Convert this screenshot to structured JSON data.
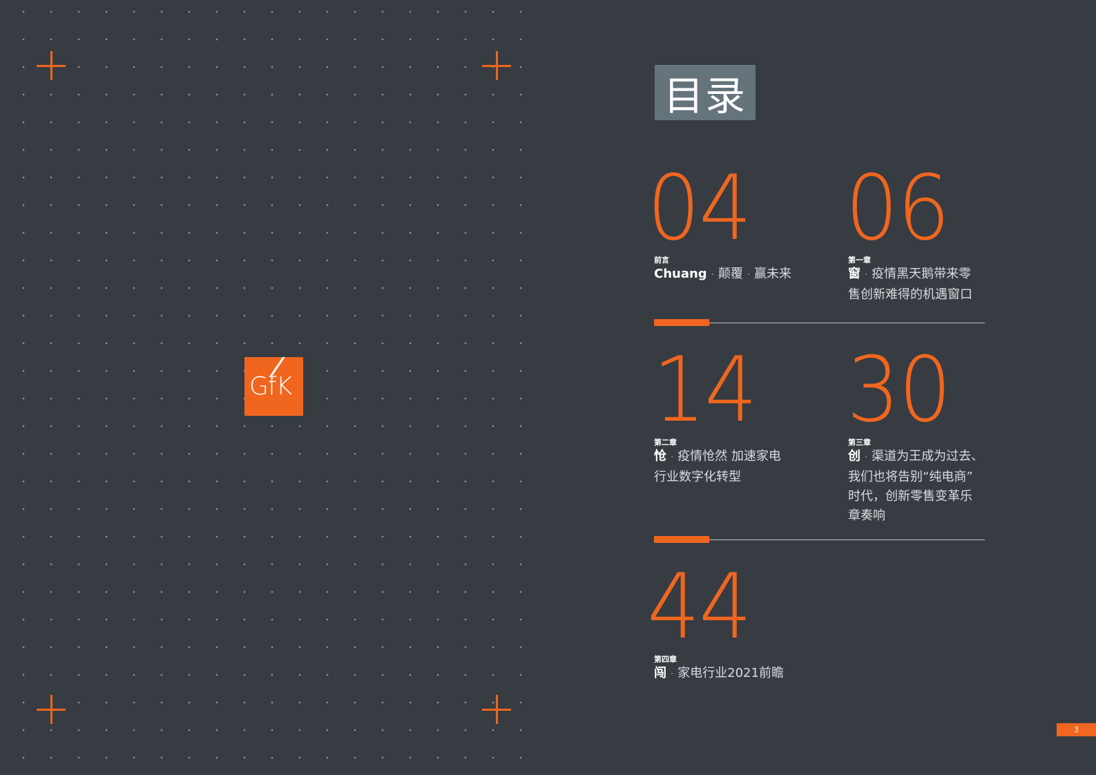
{
  "title": "目录",
  "logo": {
    "text": "GfK"
  },
  "entries": [
    {
      "number": "04",
      "label": "前言",
      "head": "Chuang",
      "sep1": "·",
      "text1": "颠覆",
      "sep2": "·",
      "text2": "赢未来"
    },
    {
      "number": "06",
      "label": "第一章",
      "head": "窗",
      "sep": "·",
      "line1": "疫情黑天鹅带来零",
      "line2": "售创新难得的机遇窗口"
    },
    {
      "number": "14",
      "label": "第二章",
      "head": "怆",
      "sep": "·",
      "line1": "疫情怆然 加速家电",
      "line2": "行业数字化转型"
    },
    {
      "number": "30",
      "label": "第三章",
      "head": "创",
      "sep": "·",
      "line1": "渠道为王成为过去、",
      "line2": "我们也将告别“纯电商”",
      "line3": "时代，创新零售变革乐",
      "line4": "章奏响"
    },
    {
      "number": "44",
      "label": "第四章",
      "head": "闯",
      "sep": "·",
      "line1": "家电行业2021前瞻"
    }
  ],
  "page_number": "3",
  "colors": {
    "background": "#363c42",
    "accent": "#f0661f",
    "title_box": "#65737b"
  }
}
